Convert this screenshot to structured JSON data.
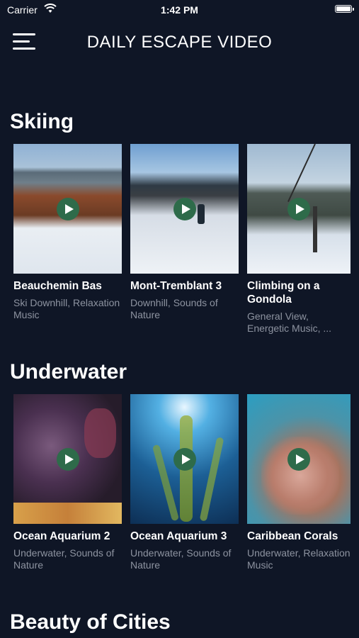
{
  "status_bar": {
    "carrier": "Carrier",
    "time": "1:42 PM"
  },
  "header": {
    "title": "DAILY ESCAPE VIDEO",
    "menu_icon": "hamburger-menu-icon"
  },
  "sections": [
    {
      "title": "Skiing",
      "videos": [
        {
          "title": "Beauchemin Bas",
          "subtitle": "Ski Downhill, Relaxation Music"
        },
        {
          "title": "Mont-Tremblant 3",
          "subtitle": "Downhill, Sounds of Nature"
        },
        {
          "title": "Climbing on a Gondola",
          "subtitle": "General View, Energetic Music, ..."
        }
      ]
    },
    {
      "title": "Underwater",
      "videos": [
        {
          "title": "Ocean Aquarium 2",
          "subtitle": "Underwater, Sounds of Nature"
        },
        {
          "title": "Ocean Aquarium 3",
          "subtitle": "Underwater, Sounds of Nature"
        },
        {
          "title": "Caribbean Corals",
          "subtitle": "Underwater, Relaxation Music"
        }
      ]
    },
    {
      "title": "Beauty of Cities"
    }
  ],
  "colors": {
    "background": "#0f1626",
    "play_button": "#2e6b4a",
    "subtitle_text": "#8d93a0"
  }
}
